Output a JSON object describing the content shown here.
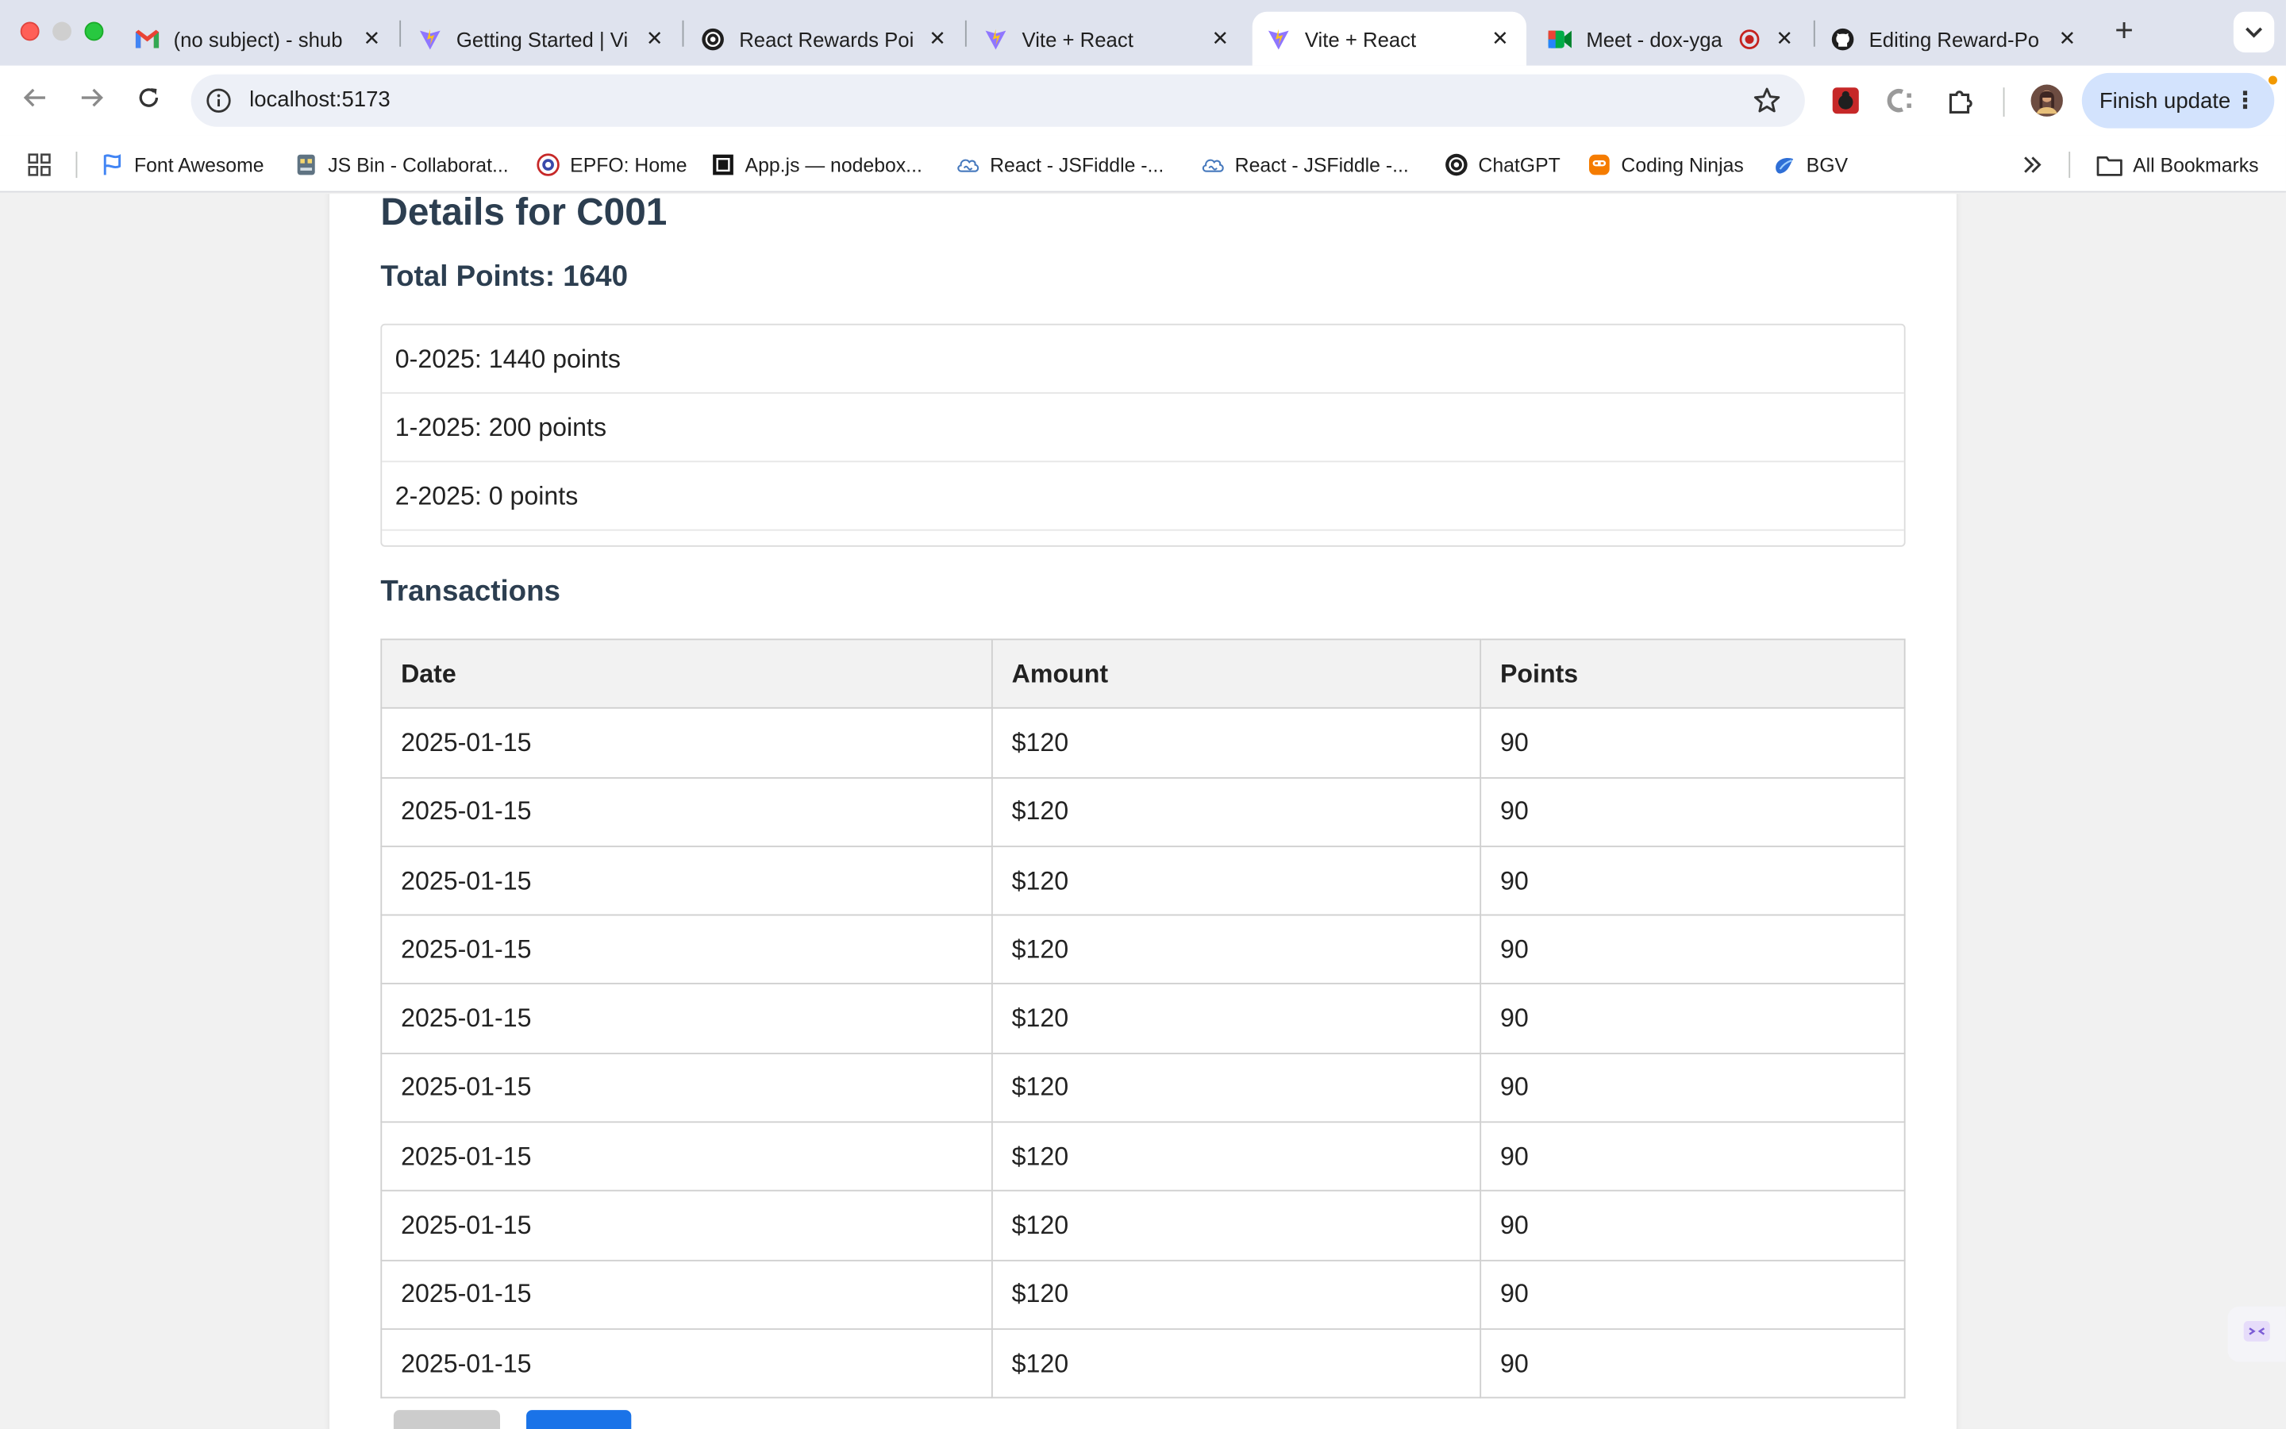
{
  "browser": {
    "tabs": [
      {
        "title": "(no subject) - shub",
        "icon": "gmail-icon"
      },
      {
        "title": "Getting Started | Vi",
        "icon": "vite-icon"
      },
      {
        "title": "React Rewards Poi",
        "icon": "chatgpt-icon"
      },
      {
        "title": "Vite + React",
        "icon": "vite-icon"
      },
      {
        "title": "Vite + React",
        "icon": "vite-icon",
        "active": true
      },
      {
        "title": "Meet - dox-yga",
        "icon": "meet-icon"
      },
      {
        "title": "Editing Reward-Po",
        "icon": "github-icon"
      }
    ],
    "url": "localhost:5173",
    "finish_update_label": "Finish update",
    "bookmarks": [
      {
        "label": "Font Awesome",
        "icon": "flag-icon"
      },
      {
        "label": "JS Bin - Collaborat...",
        "icon": "jsbin-icon"
      },
      {
        "label": "EPFO: Home",
        "icon": "epfo-icon"
      },
      {
        "label": "App.js — nodebox...",
        "icon": "codesandbox-icon"
      },
      {
        "label": "React - JSFiddle -...",
        "icon": "jsfiddle-icon"
      },
      {
        "label": "React - JSFiddle -...",
        "icon": "jsfiddle-icon"
      },
      {
        "label": "ChatGPT",
        "icon": "chatgpt-icon"
      },
      {
        "label": "Coding Ninjas",
        "icon": "codingninjas-icon"
      },
      {
        "label": "BGV",
        "icon": "bgv-icon"
      }
    ],
    "all_bookmarks_label": "All Bookmarks"
  },
  "page": {
    "heading": "Details for C001",
    "total_points": "Total Points: 1640",
    "monthly": [
      "0-2025: 1440 points",
      "1-2025: 200 points",
      "2-2025: 0 points"
    ],
    "transactions_heading": "Transactions",
    "table": {
      "headers": [
        "Date",
        "Amount",
        "Points"
      ],
      "rows": [
        [
          "2025-01-15",
          "$120",
          "90"
        ],
        [
          "2025-01-15",
          "$120",
          "90"
        ],
        [
          "2025-01-15",
          "$120",
          "90"
        ],
        [
          "2025-01-15",
          "$120",
          "90"
        ],
        [
          "2025-01-15",
          "$120",
          "90"
        ],
        [
          "2025-01-15",
          "$120",
          "90"
        ],
        [
          "2025-01-15",
          "$120",
          "90"
        ],
        [
          "2025-01-15",
          "$120",
          "90"
        ],
        [
          "2025-01-15",
          "$120",
          "90"
        ],
        [
          "2025-01-15",
          "$120",
          "90"
        ]
      ]
    },
    "colors": {
      "heading": "#2c3e50",
      "primary_button": "#1a73e8",
      "secondary_button": "#cccccc"
    }
  }
}
